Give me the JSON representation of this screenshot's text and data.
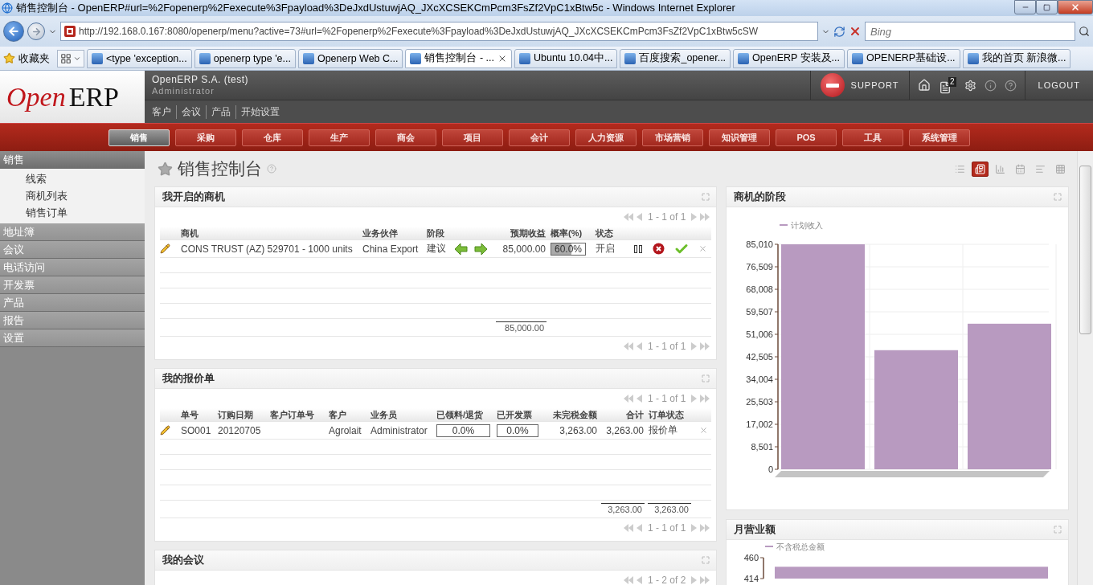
{
  "window": {
    "title": "销售控制台 - OpenERP#url=%2Fopenerp%2Fexecute%3Fpayload%3DeJxdUstuwjAQ_JXcXCSEKCmPcm3FsZf2VpC1xBtw5c - Windows Internet Explorer"
  },
  "browser": {
    "url": "http://192.168.0.167:8080/openerp/menu?active=73#url=%2Fopenerp%2Fexecute%3Fpayload%3DeJxdUstuwjAQ_JXcXCSEKCmPcm3FsZf2VpC1xBtw5cSW",
    "search_placeholder": "Bing",
    "favorites_label": "收藏夹",
    "tabs": [
      {
        "label": "<type 'exception...",
        "selected": false
      },
      {
        "label": "openerp type 'e...",
        "selected": false
      },
      {
        "label": "Openerp Web C...",
        "selected": false
      },
      {
        "label": "销售控制台 - ...",
        "selected": true
      },
      {
        "label": "Ubuntu 10.04中...",
        "selected": false
      },
      {
        "label": "百度搜索_opener...",
        "selected": false
      },
      {
        "label": "OpenERP 安装及...",
        "selected": false
      },
      {
        "label": "OPENERP基础设...",
        "selected": false
      },
      {
        "label": "我的首页 新浪微...",
        "selected": false
      }
    ]
  },
  "header": {
    "logo_open": "Open",
    "logo_erp": "ERP",
    "company": "OpenERP S.A. (test)",
    "user": "Administrator",
    "shortcuts": [
      "客户",
      "会议",
      "产品",
      "开始设置"
    ],
    "support": "SUPPORT",
    "notifications": "2",
    "logout": "LOGOUT"
  },
  "menu": [
    {
      "label": "销售",
      "selected": true
    },
    {
      "label": "采购",
      "selected": false
    },
    {
      "label": "仓库",
      "selected": false
    },
    {
      "label": "生产",
      "selected": false
    },
    {
      "label": "商会",
      "selected": false
    },
    {
      "label": "项目",
      "selected": false
    },
    {
      "label": "会计",
      "selected": false
    },
    {
      "label": "人力资源",
      "selected": false
    },
    {
      "label": "市场营销",
      "selected": false
    },
    {
      "label": "知识管理",
      "selected": false
    },
    {
      "label": "POS",
      "selected": false
    },
    {
      "label": "工具",
      "selected": false
    },
    {
      "label": "系统管理",
      "selected": false
    }
  ],
  "sidebar": [
    {
      "label": "销售",
      "expanded": true,
      "children": [
        {
          "label": "线索"
        },
        {
          "label": "商机列表"
        },
        {
          "label": "销售订单"
        }
      ]
    },
    {
      "label": "地址簿",
      "expanded": false
    },
    {
      "label": "会议",
      "expanded": false
    },
    {
      "label": "电话访问",
      "expanded": false
    },
    {
      "label": "开发票",
      "expanded": false
    },
    {
      "label": "产品",
      "expanded": false
    },
    {
      "label": "报告",
      "expanded": false
    },
    {
      "label": "设置",
      "expanded": false
    }
  ],
  "page": {
    "title": "销售控制台",
    "view_modes": [
      {
        "kind": "list",
        "selected": false
      },
      {
        "kind": "dashboard",
        "selected": true
      },
      {
        "kind": "graph",
        "selected": false
      },
      {
        "kind": "calendar",
        "selected": false
      },
      {
        "kind": "gantt",
        "selected": false
      },
      {
        "kind": "grid",
        "selected": false
      }
    ]
  },
  "opportunities": {
    "title": "我开启的商机",
    "pager_top": "1 - 1 of 1",
    "pager_bottom": "1 - 1 of 1",
    "columns": [
      "商机",
      "业务伙伴",
      "阶段",
      "预期收益",
      "概率(%)",
      "状态"
    ],
    "rows": [
      {
        "name": "CONS TRUST (AZ) 529701 - 1000 units",
        "partner": "China Export",
        "stage": "建议",
        "expected_revenue": "85,000.00",
        "probability": {
          "text": "60.0%",
          "level": 0.6
        },
        "state": "开启"
      }
    ],
    "total": "85,000.00"
  },
  "quotations": {
    "title": "我的报价单",
    "pager_top": "1 - 1 of 1",
    "pager_bottom": "1 - 1 of 1",
    "columns": [
      "单号",
      "订购日期",
      "客户订单号",
      "客户",
      "业务员",
      "已领料/退货",
      "已开发票",
      "未完税金额",
      "合计",
      "订单状态"
    ],
    "rows": [
      {
        "number": "SO001",
        "date": "20120705",
        "customer": "Agrolait",
        "salesman": "Administrator",
        "picked": {
          "text": "0.0%",
          "level": 0
        },
        "invoiced": {
          "text": "0.0%",
          "level": 0
        },
        "untaxed": "3,263.00",
        "total": "3,263.00",
        "state": "报价单"
      }
    ],
    "totals": [
      "3,263.00",
      "3,263.00"
    ]
  },
  "meetings": {
    "title": "我的会议",
    "pager_top": "1 - 2 of 2"
  },
  "stage_chart": {
    "title": "商机的阶段",
    "chart_data": {
      "type": "bar",
      "ylim": [
        0,
        85010
      ],
      "yticks": [
        {
          "value": 0,
          "label": "0"
        },
        {
          "value": 8501,
          "label": "8,501"
        },
        {
          "value": 17002,
          "label": "17,002"
        },
        {
          "value": 25503,
          "label": "25,503"
        },
        {
          "value": 34004,
          "label": "34,004"
        },
        {
          "value": 42505,
          "label": "42,505"
        },
        {
          "value": 51006,
          "label": "51,006"
        },
        {
          "value": 59507,
          "label": "59,507"
        },
        {
          "value": 68008,
          "label": "68,008"
        },
        {
          "value": 76509,
          "label": "76,509"
        },
        {
          "value": 85010,
          "label": "85,010"
        }
      ],
      "grid": true,
      "series": [
        {
          "name": "计划收入",
          "color": "#b89ac0",
          "values": [
            85000,
            45000,
            55000
          ]
        }
      ]
    }
  },
  "monthly_chart": {
    "title": "月营业额",
    "chart_data": {
      "type": "bar",
      "ylim": [
        414,
        460
      ],
      "yticks": [
        {
          "value": 414,
          "label": "414"
        },
        {
          "value": 460,
          "label": "460"
        }
      ],
      "series": [
        {
          "name": "不含税总金额",
          "color": "#b89ac0",
          "values": [
            440
          ]
        }
      ]
    }
  }
}
